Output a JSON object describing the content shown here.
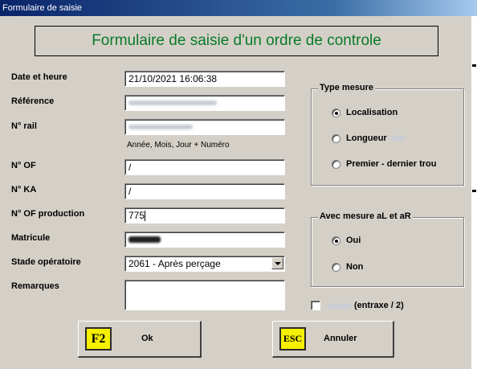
{
  "window": {
    "title": "Formulaire de saisie"
  },
  "banner": {
    "text": "Formulaire de saisie d'un ordre de controle"
  },
  "form": {
    "date_label": "Date et heure",
    "date_value": "21/10/2021 16:06:38",
    "reference_label": "Référence",
    "rail_label": "N° rail",
    "rail_hint": "Année, Mois, Jour + Numéro",
    "of_label": "N° OF",
    "of_value": "/",
    "ka_label": "N° KA",
    "ka_value": "/",
    "ofprod_label": "N° OF production",
    "ofprod_value": "775",
    "matricule_label": "Matricule",
    "stade_label": "Stade opératoire",
    "stade_value": "2061 - Après perçage",
    "remarques_label": "Remarques",
    "remarques_value": ""
  },
  "type_mesure": {
    "title": "Type mesure",
    "options": [
      {
        "label": "Localisation",
        "selected": true
      },
      {
        "label": "Longueur",
        "selected": false
      },
      {
        "label": "Premier - dernier trou",
        "selected": false
      }
    ]
  },
  "mesure_al_ar": {
    "title": "Avec mesure aL et aR",
    "options": [
      {
        "label": "Oui",
        "selected": true
      },
      {
        "label": "Non",
        "selected": false
      }
    ]
  },
  "entraxe": {
    "label": "(entraxe / 2)",
    "checked": false
  },
  "buttons": {
    "ok_key": "F2",
    "ok_label": "Ok",
    "cancel_key": "ESC",
    "cancel_label": "Annuler"
  },
  "colors": {
    "banner_text": "#0a7a28",
    "key_face": "#f5f000",
    "titlebar": "#0a246a"
  },
  "icons": {
    "ok_key_icon": "f2-key-icon",
    "cancel_key_icon": "esc-key-icon",
    "dropdown": "chevron-down-icon"
  }
}
